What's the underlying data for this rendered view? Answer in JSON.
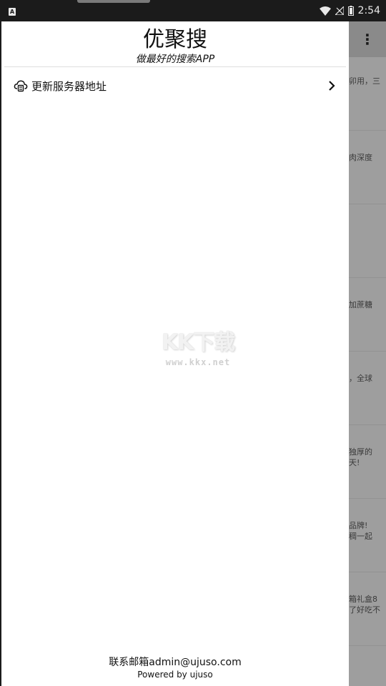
{
  "status_bar": {
    "left_icon": "A",
    "time": "2:54",
    "icons": [
      "wifi-icon",
      "no-signal-icon",
      "battery-icon"
    ]
  },
  "background": {
    "menu_icon": "⋮",
    "snippets": [
      "卯用，三",
      "肉深度",
      "",
      "加蔗糖",
      "，全球",
      "独厚的\n天!",
      "品牌!\n稠一起",
      "箱礼盒8\n了好吃不"
    ]
  },
  "drawer": {
    "title": "优聚搜",
    "subtitle": "做最好的搜索APP",
    "menu": {
      "icon": "cloud-server-icon",
      "label": "更新服务器地址",
      "chevron": "chevron-right-icon"
    },
    "watermark": {
      "logo": "KK下载",
      "url": "www.kkx.net"
    },
    "footer": {
      "email": "联系邮箱admin@ujuso.com",
      "powered": "Powered by ujuso"
    }
  },
  "colors": {
    "status_bar_bg": "#1b1b1b",
    "scrim": "#9e9e9e",
    "drawer_bg": "#ffffff",
    "text": "#111111"
  }
}
